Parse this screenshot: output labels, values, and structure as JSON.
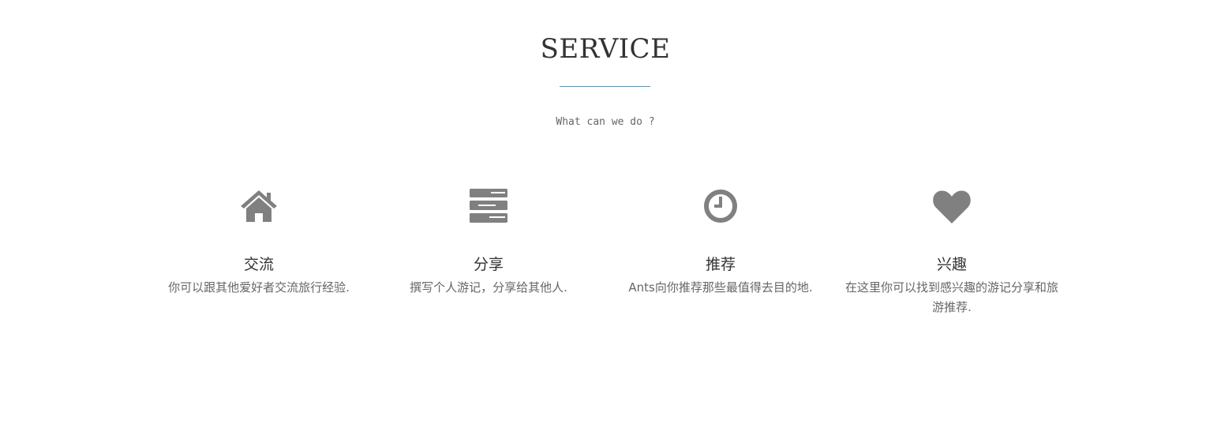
{
  "header": {
    "title": "SERVICE",
    "subtitle": "What can we do ?",
    "accent_color": "#3a9ad9"
  },
  "services": [
    {
      "icon": "home-icon",
      "title": "交流",
      "description": "你可以跟其他爱好者交流旅行经验."
    },
    {
      "icon": "tasks-icon",
      "title": "分享",
      "description": "撰写个人游记，分享给其他人."
    },
    {
      "icon": "clock-icon",
      "title": "推荐",
      "description": "Ants向你推荐那些最值得去目的地."
    },
    {
      "icon": "heart-icon",
      "title": "兴趣",
      "description": "在这里你可以找到感兴趣的游记分享和旅游推荐."
    }
  ],
  "icon_color": "#808080"
}
